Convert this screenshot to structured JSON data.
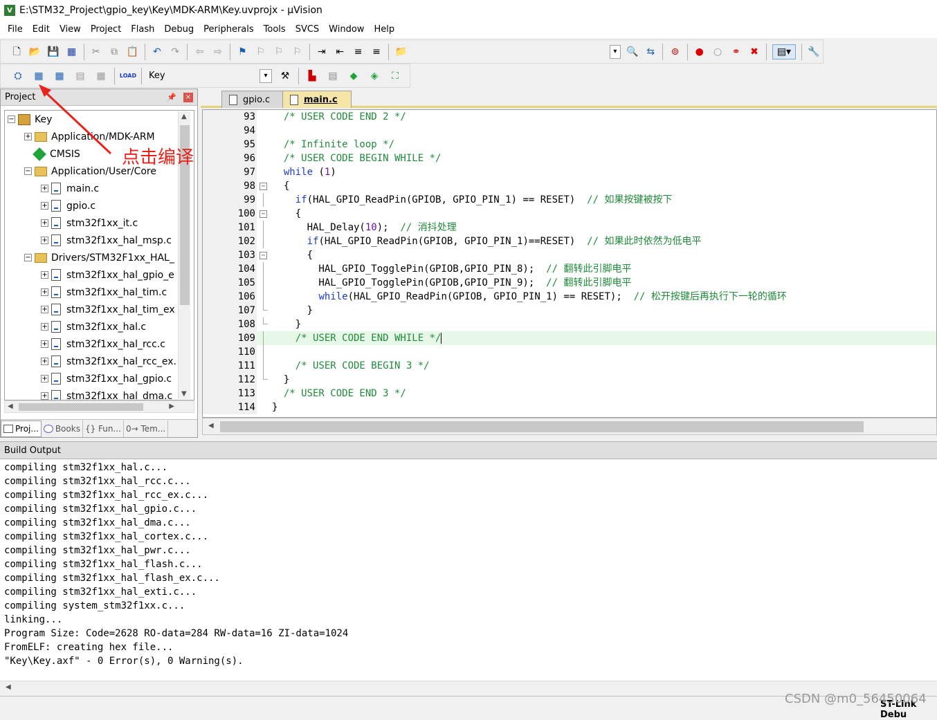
{
  "window": {
    "title": "E:\\STM32_Project\\gpio_key\\Key\\MDK-ARM\\Key.uvprojx - µVision"
  },
  "menu": [
    "File",
    "Edit",
    "View",
    "Project",
    "Flash",
    "Debug",
    "Peripherals",
    "Tools",
    "SVCS",
    "Window",
    "Help"
  ],
  "toolbar2": {
    "target": "Key",
    "load_label": "LOAD"
  },
  "project_panel": {
    "title": "Project",
    "tree": [
      {
        "label": "Key",
        "type": "target",
        "level": 0
      },
      {
        "label": "Application/MDK-ARM",
        "type": "folder",
        "level": 1
      },
      {
        "label": "CMSIS",
        "type": "gem",
        "level": 1
      },
      {
        "label": "Application/User/Core",
        "type": "folder",
        "level": 1
      },
      {
        "label": "main.c",
        "type": "file",
        "level": 2
      },
      {
        "label": "gpio.c",
        "type": "file",
        "level": 2
      },
      {
        "label": "stm32f1xx_it.c",
        "type": "file",
        "level": 2
      },
      {
        "label": "stm32f1xx_hal_msp.c",
        "type": "file",
        "level": 2
      },
      {
        "label": "Drivers/STM32F1xx_HAL_",
        "type": "folder",
        "level": 1
      },
      {
        "label": "stm32f1xx_hal_gpio_e",
        "type": "file",
        "level": 2
      },
      {
        "label": "stm32f1xx_hal_tim.c",
        "type": "file",
        "level": 2
      },
      {
        "label": "stm32f1xx_hal_tim_ex",
        "type": "file",
        "level": 2
      },
      {
        "label": "stm32f1xx_hal.c",
        "type": "file",
        "level": 2
      },
      {
        "label": "stm32f1xx_hal_rcc.c",
        "type": "file",
        "level": 2
      },
      {
        "label": "stm32f1xx_hal_rcc_ex.",
        "type": "file",
        "level": 2
      },
      {
        "label": "stm32f1xx_hal_gpio.c",
        "type": "file",
        "level": 2
      },
      {
        "label": "stm32f1xx_hal_dma.c",
        "type": "file",
        "level": 2
      }
    ],
    "tabs": [
      "Proj...",
      "Books",
      "{} Fun...",
      "0→ Tem..."
    ]
  },
  "annotation": {
    "text": "点击编译",
    "color": "#e8231c"
  },
  "editor": {
    "tabs": [
      "gpio.c",
      "main.c"
    ],
    "active_tab": "main.c",
    "lines": [
      {
        "n": "93",
        "text": "  /* USER CODE END 2 */"
      },
      {
        "n": "94",
        "text": ""
      },
      {
        "n": "95",
        "text": "  /* Infinite loop */"
      },
      {
        "n": "96",
        "text": "  /* USER CODE BEGIN WHILE */"
      },
      {
        "n": "97",
        "text": "  while (1)"
      },
      {
        "n": "98",
        "text": "  {"
      },
      {
        "n": "99",
        "text": "    if(HAL_GPIO_ReadPin(GPIOB, GPIO_PIN_1) == RESET)  // 如果按键被按下"
      },
      {
        "n": "100",
        "text": "    {"
      },
      {
        "n": "101",
        "text": "      HAL_Delay(10);  // 消抖处理"
      },
      {
        "n": "102",
        "text": "      if(HAL_GPIO_ReadPin(GPIOB, GPIO_PIN_1)==RESET)  // 如果此时依然为低电平"
      },
      {
        "n": "103",
        "text": "      {"
      },
      {
        "n": "104",
        "text": "        HAL_GPIO_TogglePin(GPIOB,GPIO_PIN_8);  // 翻转此引脚电平"
      },
      {
        "n": "105",
        "text": "        HAL_GPIO_TogglePin(GPIOB,GPIO_PIN_9);  // 翻转此引脚电平"
      },
      {
        "n": "106",
        "text": "        while(HAL_GPIO_ReadPin(GPIOB, GPIO_PIN_1) == RESET);  // 松开按键后再执行下一轮的循环"
      },
      {
        "n": "107",
        "text": "      }"
      },
      {
        "n": "108",
        "text": "    }"
      },
      {
        "n": "109",
        "text": "    /* USER CODE END WHILE */"
      },
      {
        "n": "110",
        "text": ""
      },
      {
        "n": "111",
        "text": "    /* USER CODE BEGIN 3 */"
      },
      {
        "n": "112",
        "text": "  }"
      },
      {
        "n": "113",
        "text": "  /* USER CODE END 3 */"
      },
      {
        "n": "114",
        "text": "}"
      }
    ]
  },
  "build_output": {
    "title": "Build Output",
    "lines": [
      "compiling stm32f1xx_hal.c...",
      "compiling stm32f1xx_hal_rcc.c...",
      "compiling stm32f1xx_hal_rcc_ex.c...",
      "compiling stm32f1xx_hal_gpio.c...",
      "compiling stm32f1xx_hal_dma.c...",
      "compiling stm32f1xx_hal_cortex.c...",
      "compiling stm32f1xx_hal_pwr.c...",
      "compiling stm32f1xx_hal_flash.c...",
      "compiling stm32f1xx_hal_flash_ex.c...",
      "compiling stm32f1xx_hal_exti.c...",
      "compiling system_stm32f1xx.c...",
      "linking...",
      "Program Size: Code=2628 RO-data=284 RW-data=16 ZI-data=1024",
      "FromELF: creating hex file...",
      "\"Key\\Key.axf\" - 0 Error(s), 0 Warning(s)."
    ]
  },
  "status": {
    "debugger": "ST-Link Debu"
  },
  "watermark": "CSDN @m0_56450064"
}
